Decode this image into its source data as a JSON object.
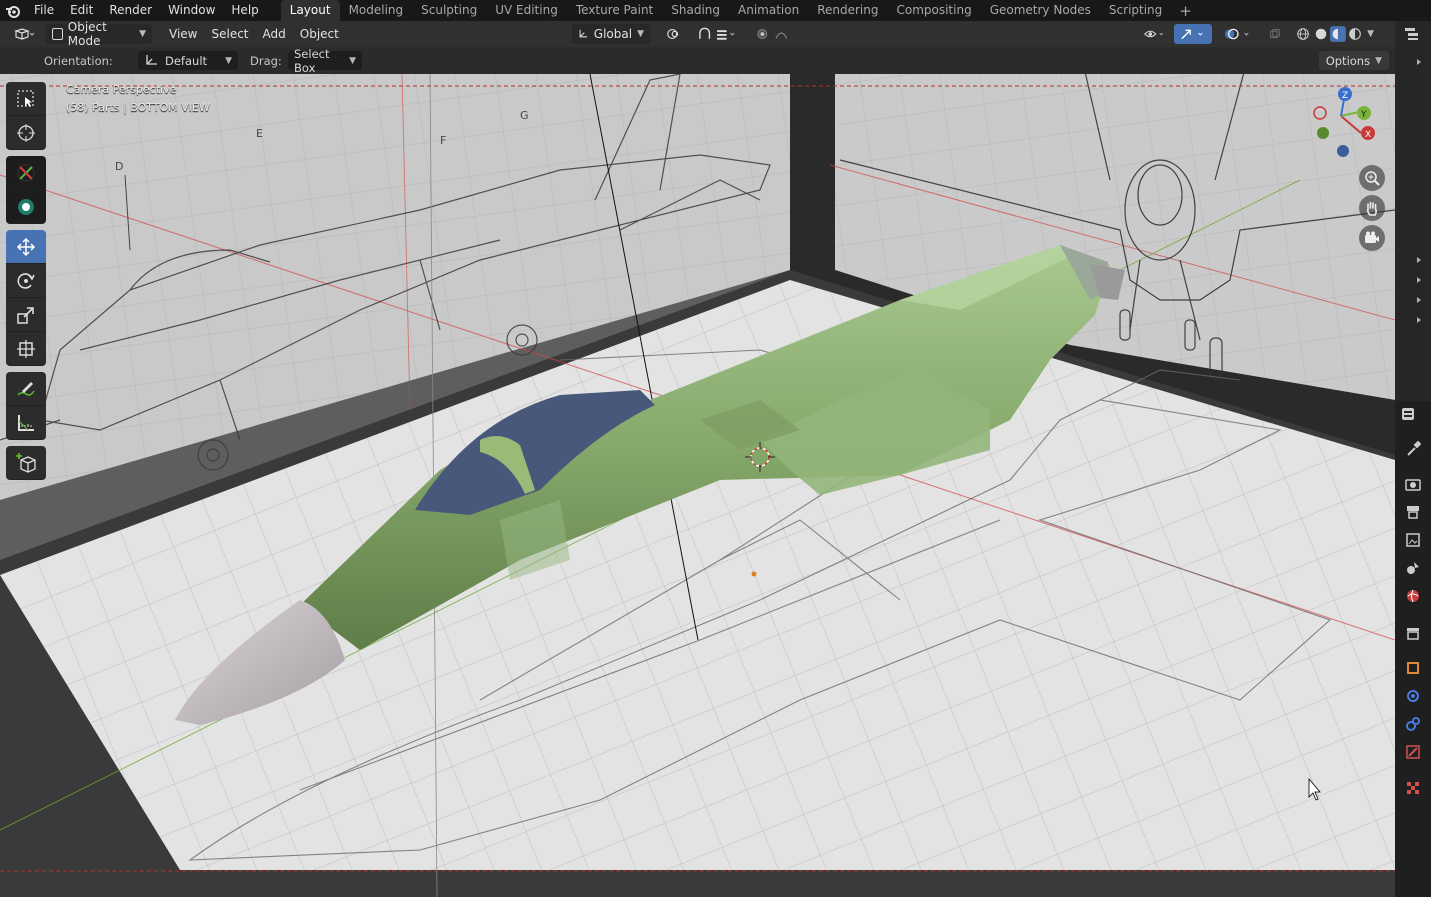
{
  "app": {
    "menus": [
      "File",
      "Edit",
      "Render",
      "Window",
      "Help"
    ],
    "workspace_tabs": [
      "Layout",
      "Modeling",
      "Sculpting",
      "UV Editing",
      "Texture Paint",
      "Shading",
      "Animation",
      "Rendering",
      "Compositing",
      "Geometry Nodes",
      "Scripting"
    ],
    "active_tab": "Layout"
  },
  "header": {
    "mode": "Object Mode",
    "menus": [
      "View",
      "Select",
      "Add",
      "Object"
    ],
    "transform_orientation": "Global"
  },
  "tool_settings": {
    "orientation_label": "Orientation:",
    "orientation_value": "Default",
    "drag_label": "Drag:",
    "drag_value": "Select Box",
    "options_label": "Options"
  },
  "viewport": {
    "camera_label": "Camera Perspective",
    "collection_label": "(58) Parts | BOTTOM VIEW",
    "blueprint_letters": [
      "D",
      "E",
      "F",
      "G"
    ],
    "axis_labels": {
      "x": "X",
      "y": "Y",
      "z": "Z"
    },
    "colors": {
      "fuselage": "#86a86a",
      "canopy": "#47587a",
      "nose": "#bcb6bb",
      "axis_x": "#c83a3a",
      "axis_y": "#7ab43a",
      "axis_z": "#3a6fd0",
      "active_tool": "#4772b3"
    }
  },
  "toolbar": {
    "tools": [
      "select-box",
      "cursor",
      "move-gizmo",
      "transform-gizmo",
      "move",
      "rotate",
      "scale",
      "transform",
      "annotate",
      "measure",
      "add-cube"
    ],
    "active_tool": "move"
  },
  "properties_tabs": [
    "tool",
    "render",
    "output",
    "view-layer",
    "scene",
    "world",
    "collection",
    "object",
    "modifiers",
    "physics",
    "constraints",
    "data",
    "texture"
  ]
}
